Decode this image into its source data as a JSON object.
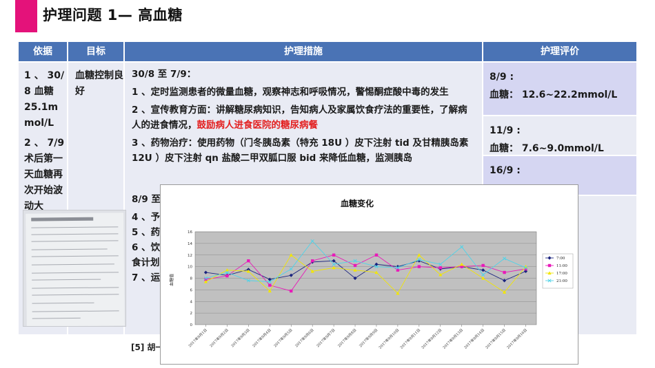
{
  "slide": {
    "title": "护理问题 1— 高血糖"
  },
  "table": {
    "headers": [
      "依据",
      "目标",
      "护理措施",
      "护理评价"
    ],
    "basis": [
      "1 、 30/ 8 血糖 25.1m mol/L",
      "2 、 7/9 术后第一天血糖再次开始波动大"
    ],
    "goal": "血糖控制良好",
    "measures": {
      "period1": "30/8 至 7/9：",
      "item1": "1 、定时监测患者的微量血糖，观察神志和呼吸情况，警惕酮症酸中毒的发生",
      "item2_text": "2 、宣传教育方面：讲解糖尿病知识，告知病人及家属饮食疗法的重要性，了解病人的进食情况，",
      "item2_highlight": "鼓励病人进食医院的糖尿病餐",
      "item3": "3 、药物治疗：使用药物（门冬胰岛素（特充 18U ）皮下注射 tid 及甘精胰岛素 12U ）皮下注射 qn 盐酸二甲双胍口服 bid 来降低血糖，监测胰岛",
      "period2": "8/9 至",
      "item4": "4 、予",
      "item5": "5 、药",
      "item6": "6 、饮",
      "item6b": "食计划",
      "item7": "7 、运"
    },
    "evaluation": [
      {
        "date": "8/9 :",
        "value": "血糖： 12.6~22.2mmol/L"
      },
      {
        "date": "11/9 :",
        "value": "血糖： 7.6~9.0mmol/L"
      },
      {
        "date": "16/9 :",
        "value": ""
      }
    ]
  },
  "citation": "[5] 胡一",
  "colors": {
    "accent": "#e4127a",
    "header_bg": "#4a73b5",
    "row_bg": "#e9ebf4",
    "eval_alt_bg": "#d5d6f2",
    "highlight": "#e32020"
  },
  "chart_data": {
    "type": "line",
    "title": "血糖变化",
    "ylabel": "血糖值",
    "xlabel": "",
    "ylim": [
      0,
      16
    ],
    "yticks": [
      0,
      2,
      4,
      6,
      8,
      10,
      12,
      14,
      16
    ],
    "categories": [
      "2017年9月1日",
      "2017年9月2日",
      "2017年9月3日",
      "2017年9月4日",
      "2017年9月5日",
      "2017年9月6日",
      "2017年9月7日",
      "2017年9月8日",
      "2017年9月9日",
      "2017年9月10日",
      "2017年9月11日",
      "2017年9月12日",
      "2017年9月13日",
      "2017年9月14日",
      "2017年9月15日",
      "2017年9月16日"
    ],
    "legend_position": "right",
    "plot_background": "#c0c0c0",
    "grid": true,
    "series": [
      {
        "name": "7:00",
        "color": "#1a237e",
        "marker": "diamond",
        "values": [
          9.0,
          8.5,
          9.5,
          7.8,
          8.5,
          10.8,
          11.0,
          8.0,
          10.4,
          10.0,
          11.0,
          9.6,
          10.0,
          9.4,
          7.6,
          9.2
        ]
      },
      {
        "name": "11:00",
        "color": "#e81ab8",
        "marker": "square",
        "values": [
          7.8,
          8.4,
          11.0,
          6.8,
          5.8,
          11.0,
          12.0,
          10.2,
          12.0,
          9.4,
          10.0,
          9.8,
          10.0,
          10.2,
          9.0,
          9.6
        ]
      },
      {
        "name": "17:00",
        "color": "#f2e600",
        "marker": "triangle",
        "values": [
          7.4,
          9.4,
          9.2,
          5.8,
          12.0,
          9.2,
          9.8,
          9.4,
          9.0,
          5.4,
          12.0,
          8.6,
          10.4,
          8.0,
          5.6,
          10.0
        ]
      },
      {
        "name": "21:00",
        "color": "#4fd3e8",
        "marker": "x",
        "values": [
          8.0,
          9.0,
          7.6,
          7.4,
          9.6,
          14.4,
          10.4,
          11.0,
          10.0,
          9.8,
          11.2,
          10.4,
          13.4,
          8.6,
          11.4,
          9.8
        ]
      }
    ]
  }
}
